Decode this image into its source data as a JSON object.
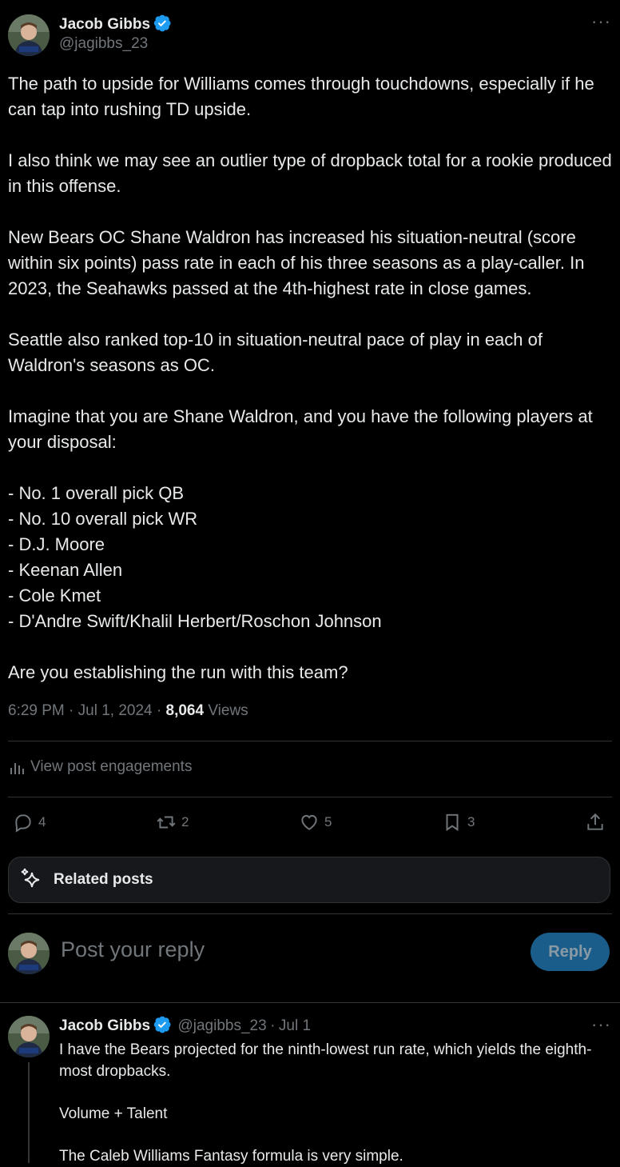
{
  "author": {
    "name": "Jacob Gibbs",
    "handle": "@jagibbs_23",
    "avatar_caption": "jagibbs_23"
  },
  "post": {
    "text": "The path to upside for Williams comes through touchdowns, especially if he can tap into rushing TD upside.\n\nI also think we may see an outlier type of dropback total for a rookie produced in this offense.\n\nNew Bears OC Shane Waldron has increased his situation-neutral (score within six points) pass rate in each of his three seasons as a play-caller. In 2023, the Seahawks passed at the 4th-highest rate in close games.\n\nSeattle also ranked top-10 in situation-neutral pace of play in each of Waldron's seasons as OC.\n\nImagine that you are Shane Waldron, and you have the following players at your disposal:\n\n- No. 1 overall pick QB\n- No. 10 overall pick WR\n- D.J. Moore\n- Keenan Allen\n- Cole Kmet\n- D'Andre Swift/Khalil Herbert/Roschon Johnson\n\nAre you establishing the run with this team?",
    "time": "6:29 PM",
    "date": "Jul 1, 2024",
    "views_count": "8,064",
    "views_label": "Views",
    "separator": " · "
  },
  "engagements_label": "View post engagements",
  "actions": {
    "replies": "4",
    "reposts": "2",
    "likes": "5",
    "bookmarks": "3"
  },
  "related_posts_label": "Related posts",
  "reply_box": {
    "placeholder": "Post your reply",
    "button": "Reply"
  },
  "reply": {
    "name": "Jacob Gibbs",
    "handle": "@jagibbs_23",
    "date": "Jul 1",
    "dot": "·",
    "text": "I have the Bears projected for the ninth-lowest run rate, which yields the eighth-most dropbacks.\n\nVolume + Talent\n\nThe Caleb Williams Fantasy formula is very simple."
  },
  "colors": {
    "accent": "#1d9bf0",
    "muted": "#71767b",
    "reply_button_bg": "#1b5d8a"
  }
}
